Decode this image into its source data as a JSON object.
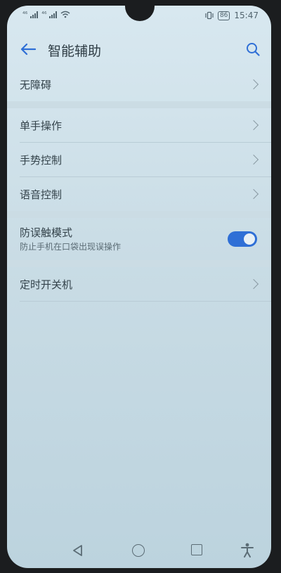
{
  "status_bar": {
    "signal_1": "⁴⁶",
    "signal_2": "⁴⁶",
    "battery": "86",
    "time": "15:47"
  },
  "header": {
    "title": "智能辅助"
  },
  "list": {
    "accessibility": "无障碍",
    "one_hand": "单手操作",
    "gesture_control": "手势控制",
    "voice_control": "语音控制",
    "anti_mistouch_title": "防误触模式",
    "anti_mistouch_subtitle": "防止手机在口袋出现误操作",
    "anti_mistouch_enabled": true,
    "scheduled_power": "定时开关机"
  },
  "colors": {
    "accent": "#2f6fd6",
    "background": "#d8e8f0",
    "text": "#34434b"
  },
  "icons": {
    "back": "back-arrow-icon",
    "search": "search-icon",
    "chevron": "chevron-right-icon",
    "nav_back": "nav-back-icon",
    "nav_home": "nav-home-icon",
    "nav_recent": "nav-recent-icon",
    "accessibility": "accessibility-icon"
  }
}
